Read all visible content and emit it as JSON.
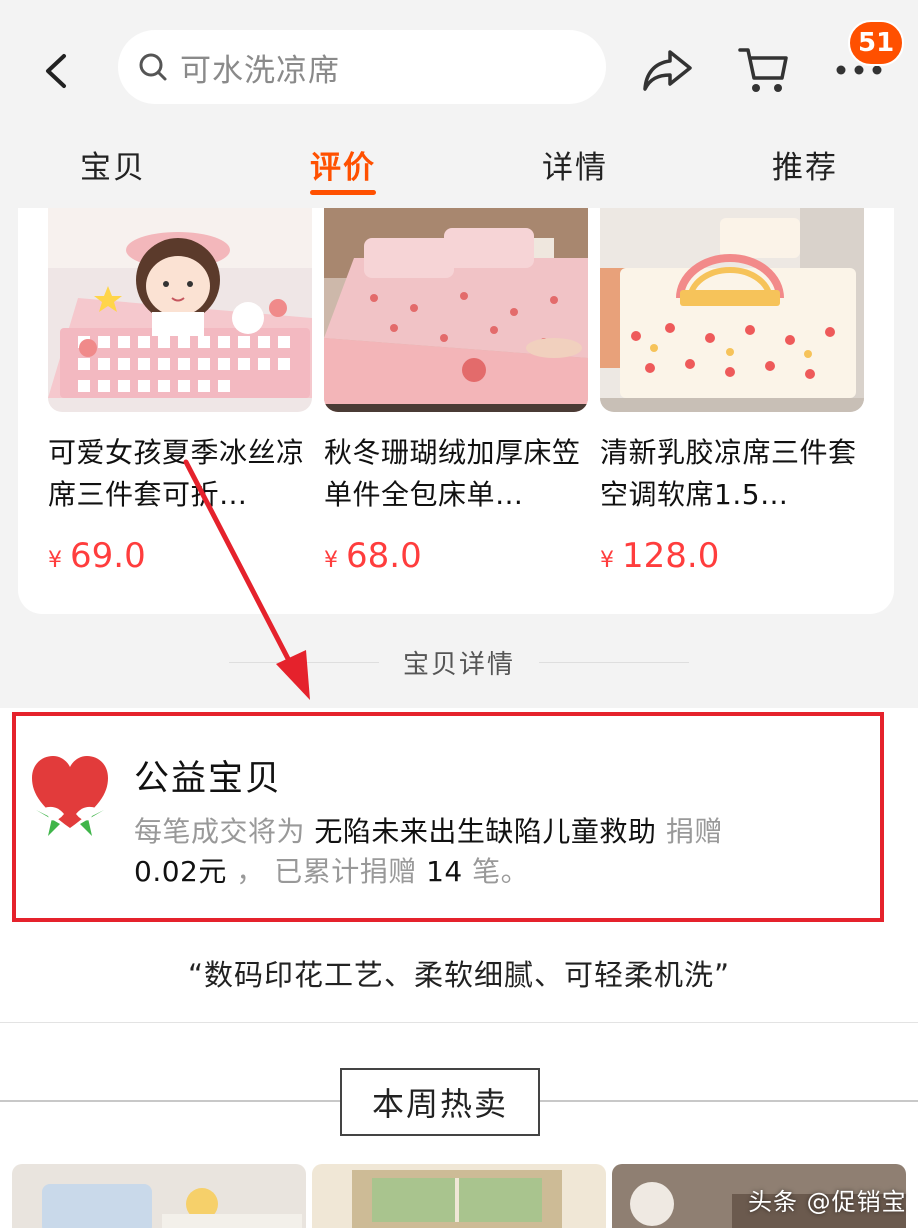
{
  "header": {
    "search_placeholder": "可水洗凉席",
    "cart_badge": "51"
  },
  "tabs": [
    {
      "label": "宝贝",
      "active": false
    },
    {
      "label": "评价",
      "active": true
    },
    {
      "label": "详情",
      "active": false
    },
    {
      "label": "推荐",
      "active": false
    }
  ],
  "recommend": [
    {
      "title": "可爱女孩夏季冰丝凉席三件套可折…",
      "currency": "¥",
      "price": "69.0"
    },
    {
      "title": "秋冬珊瑚绒加厚床笠单件全包床单…",
      "currency": "¥",
      "price": "68.0"
    },
    {
      "title": "清新乳胶凉席三件套空调软席1.5…",
      "currency": "¥",
      "price": "128.0"
    }
  ],
  "section_title": "宝贝详情",
  "charity": {
    "title": "公益宝贝",
    "desc_prefix": "每笔成交将为",
    "program": "无陷未来出生缺陷儿童救助",
    "desc_mid": "捐赠",
    "amount": "0.02元",
    "desc_sep": "，",
    "desc_total_prefix": "已累计捐赠",
    "count": "14",
    "desc_suffix": "笔。"
  },
  "quote": "“数码印花工艺、柔软细腻、可轻柔机洗”",
  "hot_title": "本周热卖",
  "watermark": "头条 @促销宝",
  "colors": {
    "accent": "#ff5000",
    "price": "#ff3d3d",
    "annotation": "#e5222c"
  }
}
